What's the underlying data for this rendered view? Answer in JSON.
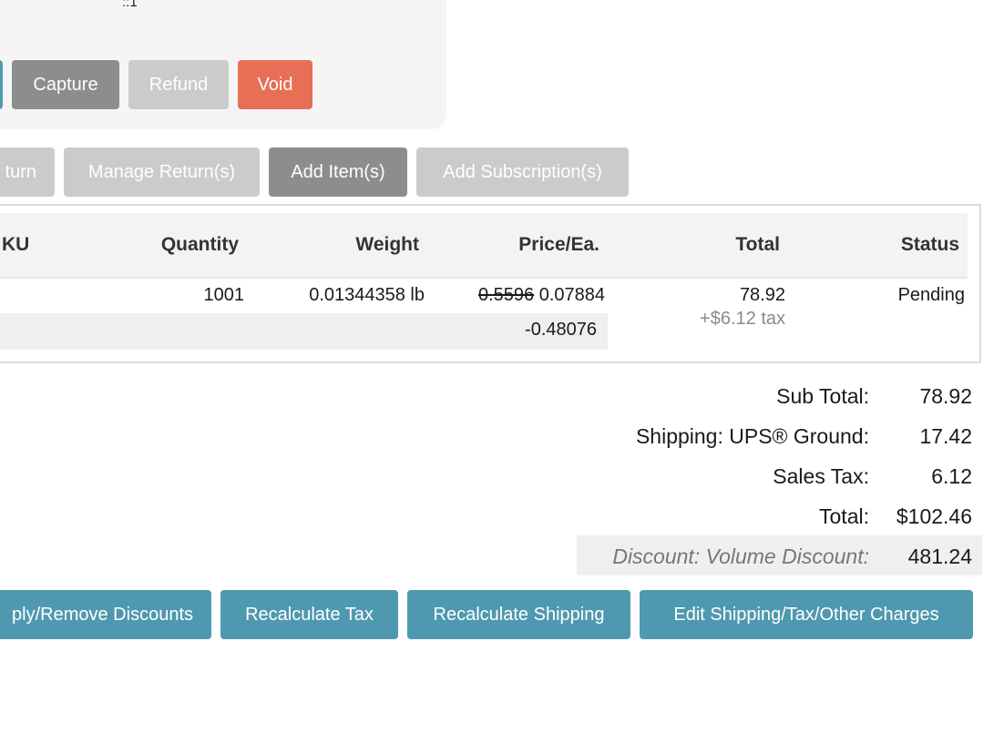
{
  "panel": {
    "fragment_text": "::1"
  },
  "payment_actions": {
    "capture": "Capture",
    "refund": "Refund",
    "void": "Void"
  },
  "item_actions": {
    "return_partial": "turn",
    "manage_returns": "Manage Return(s)",
    "add_items": "Add Item(s)",
    "add_subscriptions": "Add Subscription(s)"
  },
  "table": {
    "headers": {
      "sku_partial": "KU",
      "quantity": "Quantity",
      "weight": "Weight",
      "price": "Price/Ea.",
      "total": "Total",
      "status": "Status"
    },
    "rows": [
      {
        "quantity": "1001",
        "weight": "0.01344358 lb",
        "original_price": "0.5596",
        "price": "0.07884",
        "discount": "-0.48076",
        "total": "78.92",
        "tax_note": "+$6.12 tax",
        "status": "Pending"
      }
    ]
  },
  "summary": {
    "subtotal_label": "Sub Total:",
    "subtotal_value": "78.92",
    "shipping_label": "Shipping: UPS® Ground:",
    "shipping_value": "17.42",
    "tax_label": "Sales Tax:",
    "tax_value": "6.12",
    "total_label": "Total:",
    "total_value": "$102.46",
    "discount_label": "Discount: Volume Discount:",
    "discount_value": "481.24"
  },
  "bottom_actions": {
    "discounts_partial": "ply/Remove Discounts",
    "recalc_tax": "Recalculate Tax",
    "recalc_shipping": "Recalculate Shipping",
    "edit_charges": "Edit Shipping/Tax/Other Charges"
  },
  "colors": {
    "void": "#e86f55",
    "teal": "#4f99b0",
    "gray_button": "#8d8d8d",
    "disabled_button": "#cbcbcb"
  }
}
